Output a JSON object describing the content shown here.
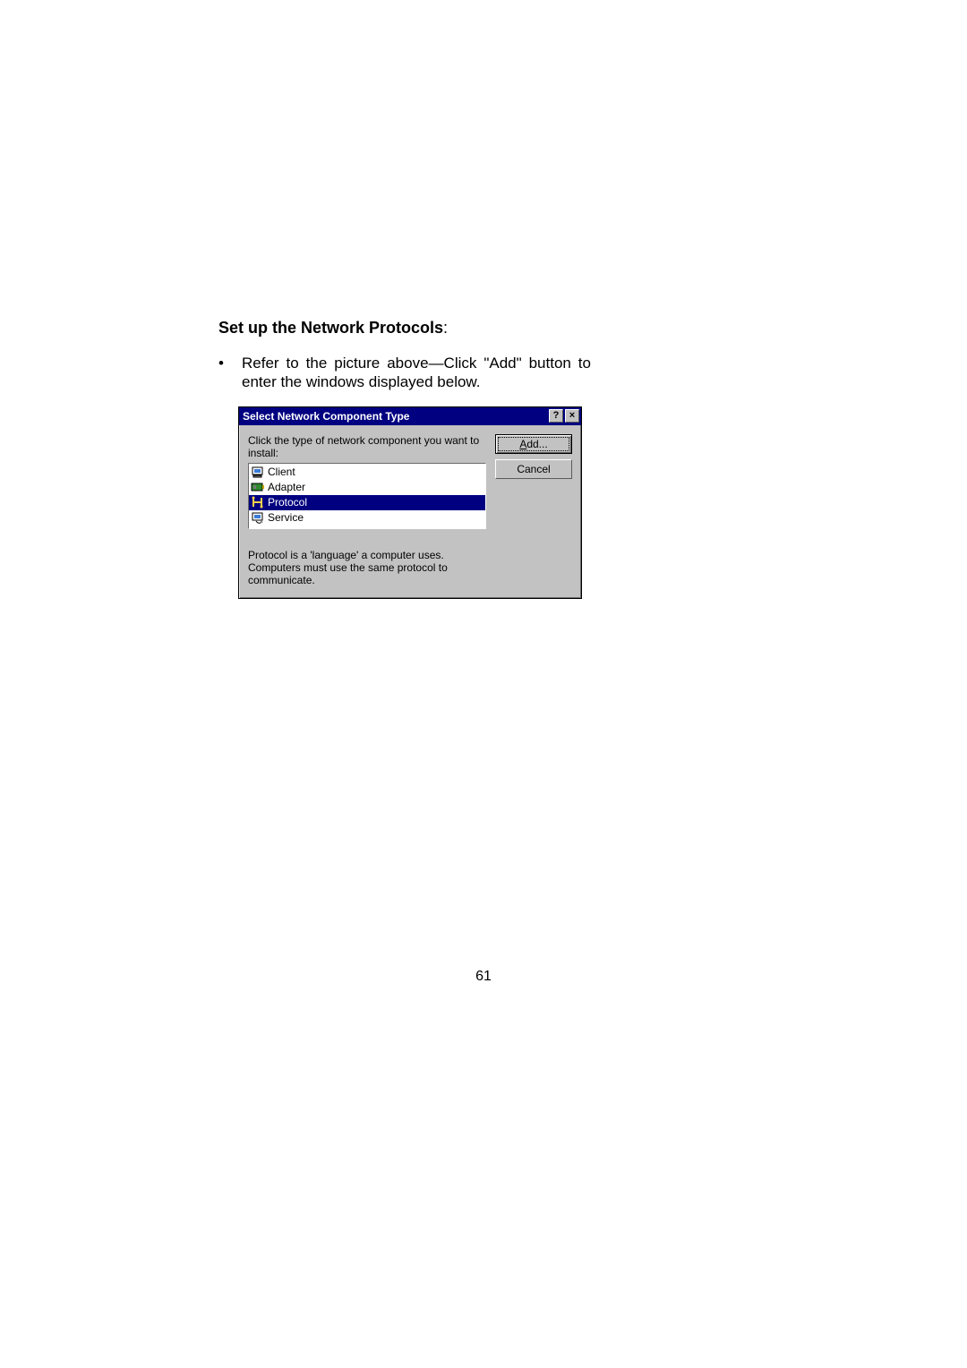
{
  "heading": "Set up the Network Protocols",
  "heading_colon": ":",
  "bullet": "Refer to the picture above—Click \"Add\" button to enter the windows displayed below.",
  "dialog": {
    "title": "Select Network Component Type",
    "help_glyph": "?",
    "close_glyph": "×",
    "instruction": "Click the type of network component you want to install:",
    "items": [
      {
        "label": "Client",
        "icon": "client-icon",
        "selected": false
      },
      {
        "label": "Adapter",
        "icon": "adapter-icon",
        "selected": false
      },
      {
        "label": "Protocol",
        "icon": "protocol-icon",
        "selected": true
      },
      {
        "label": "Service",
        "icon": "service-icon",
        "selected": false
      }
    ],
    "add_prefix": "A",
    "add_rest": "dd...",
    "cancel_label": "Cancel",
    "description": "Protocol is a 'language' a computer uses. Computers must use the same protocol to communicate."
  },
  "page_number": "61"
}
